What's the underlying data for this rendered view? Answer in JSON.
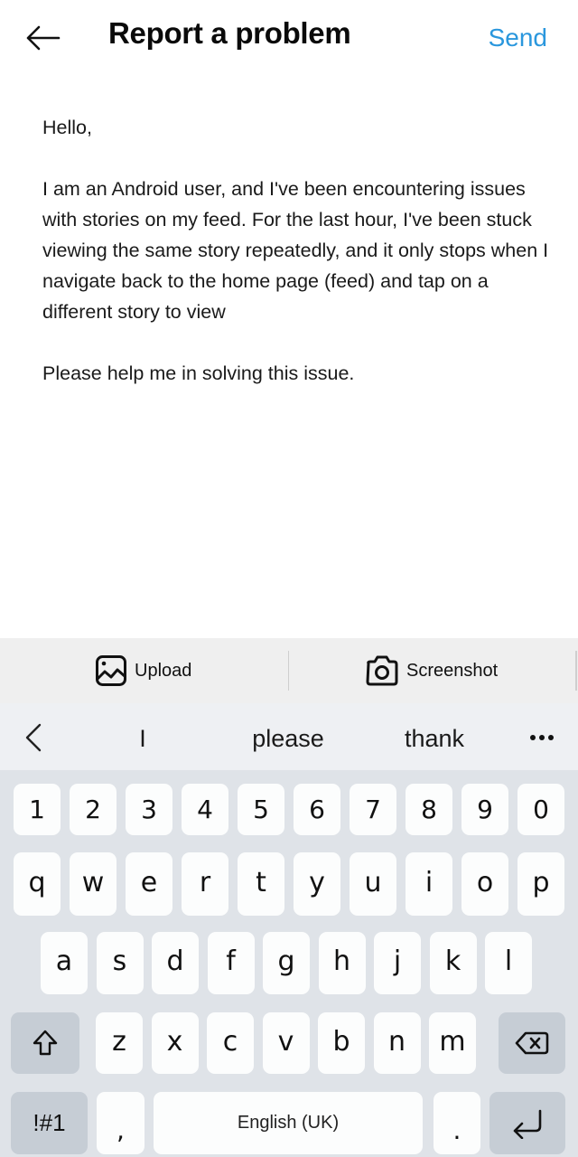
{
  "header": {
    "title": "Report a problem",
    "send_label": "Send",
    "back_icon": "arrow-left-icon",
    "accent_color": "#2a97dd"
  },
  "message": {
    "paragraphs": [
      "Hello,",
      "I am an Android user, and I've been encountering issues with stories on my feed. For the last hour, I've been stuck viewing the same story repeatedly, and it only stops when I navigate back to the home page (feed) and tap on a different story to view",
      "Please help me in solving this issue."
    ]
  },
  "attachments": {
    "upload": {
      "icon": "image-icon",
      "label": "Upload"
    },
    "screenshot": {
      "icon": "camera-icon",
      "label": "Screenshot"
    }
  },
  "suggestions": {
    "back_icon": "chevron-left-icon",
    "items": [
      "I",
      "please",
      "thank"
    ],
    "more_icon": "more-dots-icon"
  },
  "keyboard": {
    "number_row": [
      "1",
      "2",
      "3",
      "4",
      "5",
      "6",
      "7",
      "8",
      "9",
      "0"
    ],
    "row1": [
      "q",
      "w",
      "e",
      "r",
      "t",
      "y",
      "u",
      "i",
      "o",
      "p"
    ],
    "row2": [
      "a",
      "s",
      "d",
      "f",
      "g",
      "h",
      "j",
      "k",
      "l"
    ],
    "row3": [
      "z",
      "x",
      "c",
      "v",
      "b",
      "n",
      "m"
    ],
    "shift_icon": "shift-icon",
    "backspace_icon": "backspace-icon",
    "symbols_label": "!#1",
    "comma_label": ",",
    "space_label": "English (UK)",
    "period_label": ".",
    "enter_icon": "enter-icon"
  }
}
